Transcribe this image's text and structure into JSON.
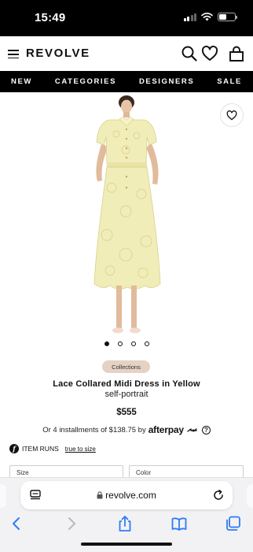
{
  "status_bar": {
    "time": "15:49"
  },
  "header": {
    "logo": "REVOLVE"
  },
  "nav": {
    "items": [
      "NEW",
      "CATEGORIES",
      "DESIGNERS",
      "SALE"
    ]
  },
  "product": {
    "badge": "Collections",
    "title": "Lace Collared Midi Dress in Yellow",
    "brand": "self-portrait",
    "price": "$555",
    "installments_text": "Or 4 installments of $138.75 by",
    "afterpay_label": "afterpay",
    "info_symbol": "?",
    "image_dots": 4,
    "active_dot": 1
  },
  "fit": {
    "label": "ITEM RUNS",
    "link": "true to size",
    "icon_letter": "f"
  },
  "selectors": {
    "size_label": "Size",
    "color_label": "Color"
  },
  "browser": {
    "url": "revolve.com"
  },
  "colors": {
    "accent_black": "#000000",
    "badge_bg": "#e5d2c4",
    "dress_yellow": "#f1edb8",
    "ios_blue": "#2f7bf5"
  },
  "icons": [
    "search-icon",
    "heart-icon",
    "bag-icon",
    "menu-icon",
    "lock-icon",
    "reload-icon",
    "tabs-icon",
    "share-icon",
    "bookmarks-icon",
    "back-icon",
    "forward-icon"
  ]
}
